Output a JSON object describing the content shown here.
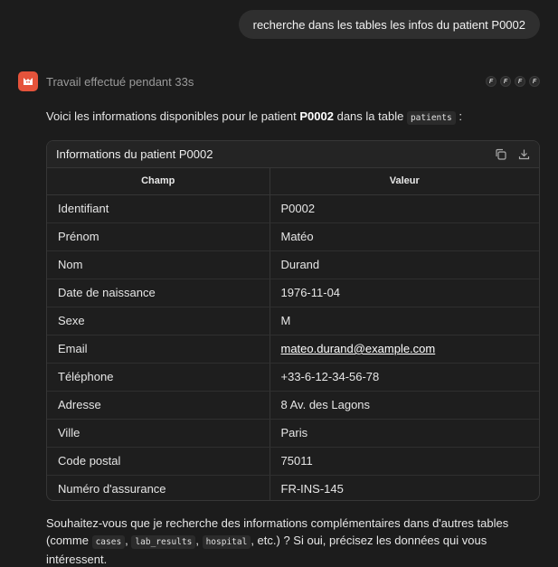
{
  "user_message": "recherche dans les tables les infos du patient P0002",
  "agent": {
    "work_status": "Travail effectué pendant 33s",
    "tool_icons": [
      "F",
      "F",
      "F",
      "F"
    ]
  },
  "intro": {
    "text_1": "Voici les informations disponibles pour le patient ",
    "patient_id": "P0002",
    "text_2": " dans la table ",
    "table_name": "patients",
    "text_3": " :"
  },
  "table": {
    "title": "Informations du patient P0002",
    "columns": [
      "Champ",
      "Valeur"
    ],
    "rows": [
      [
        "Identifiant",
        "P0002"
      ],
      [
        "Prénom",
        "Matéo"
      ],
      [
        "Nom",
        "Durand"
      ],
      [
        "Date de naissance",
        "1976-11-04"
      ],
      [
        "Sexe",
        "M"
      ],
      [
        "Email",
        "mateo.durand@example.com"
      ],
      [
        "Téléphone",
        "+33-6-12-34-56-78"
      ],
      [
        "Adresse",
        "8 Av. des Lagons"
      ],
      [
        "Ville",
        "Paris"
      ],
      [
        "Code postal",
        "75011"
      ],
      [
        "Numéro d'assurance",
        "FR-INS-145"
      ]
    ]
  },
  "outro": {
    "text_1": "Souhaitez-vous que je recherche des informations complémentaires dans d'autres tables (comme ",
    "code_1": "cases",
    "sep_1": ", ",
    "code_2": "lab_results",
    "sep_2": ", ",
    "code_3": "hospital",
    "text_2": ", etc.) ? Si oui, précisez les données qui vous intéressent."
  },
  "colors": {
    "background": "#1c1c1c",
    "accent": "#e5533b",
    "bubble": "#2f2f2f"
  }
}
